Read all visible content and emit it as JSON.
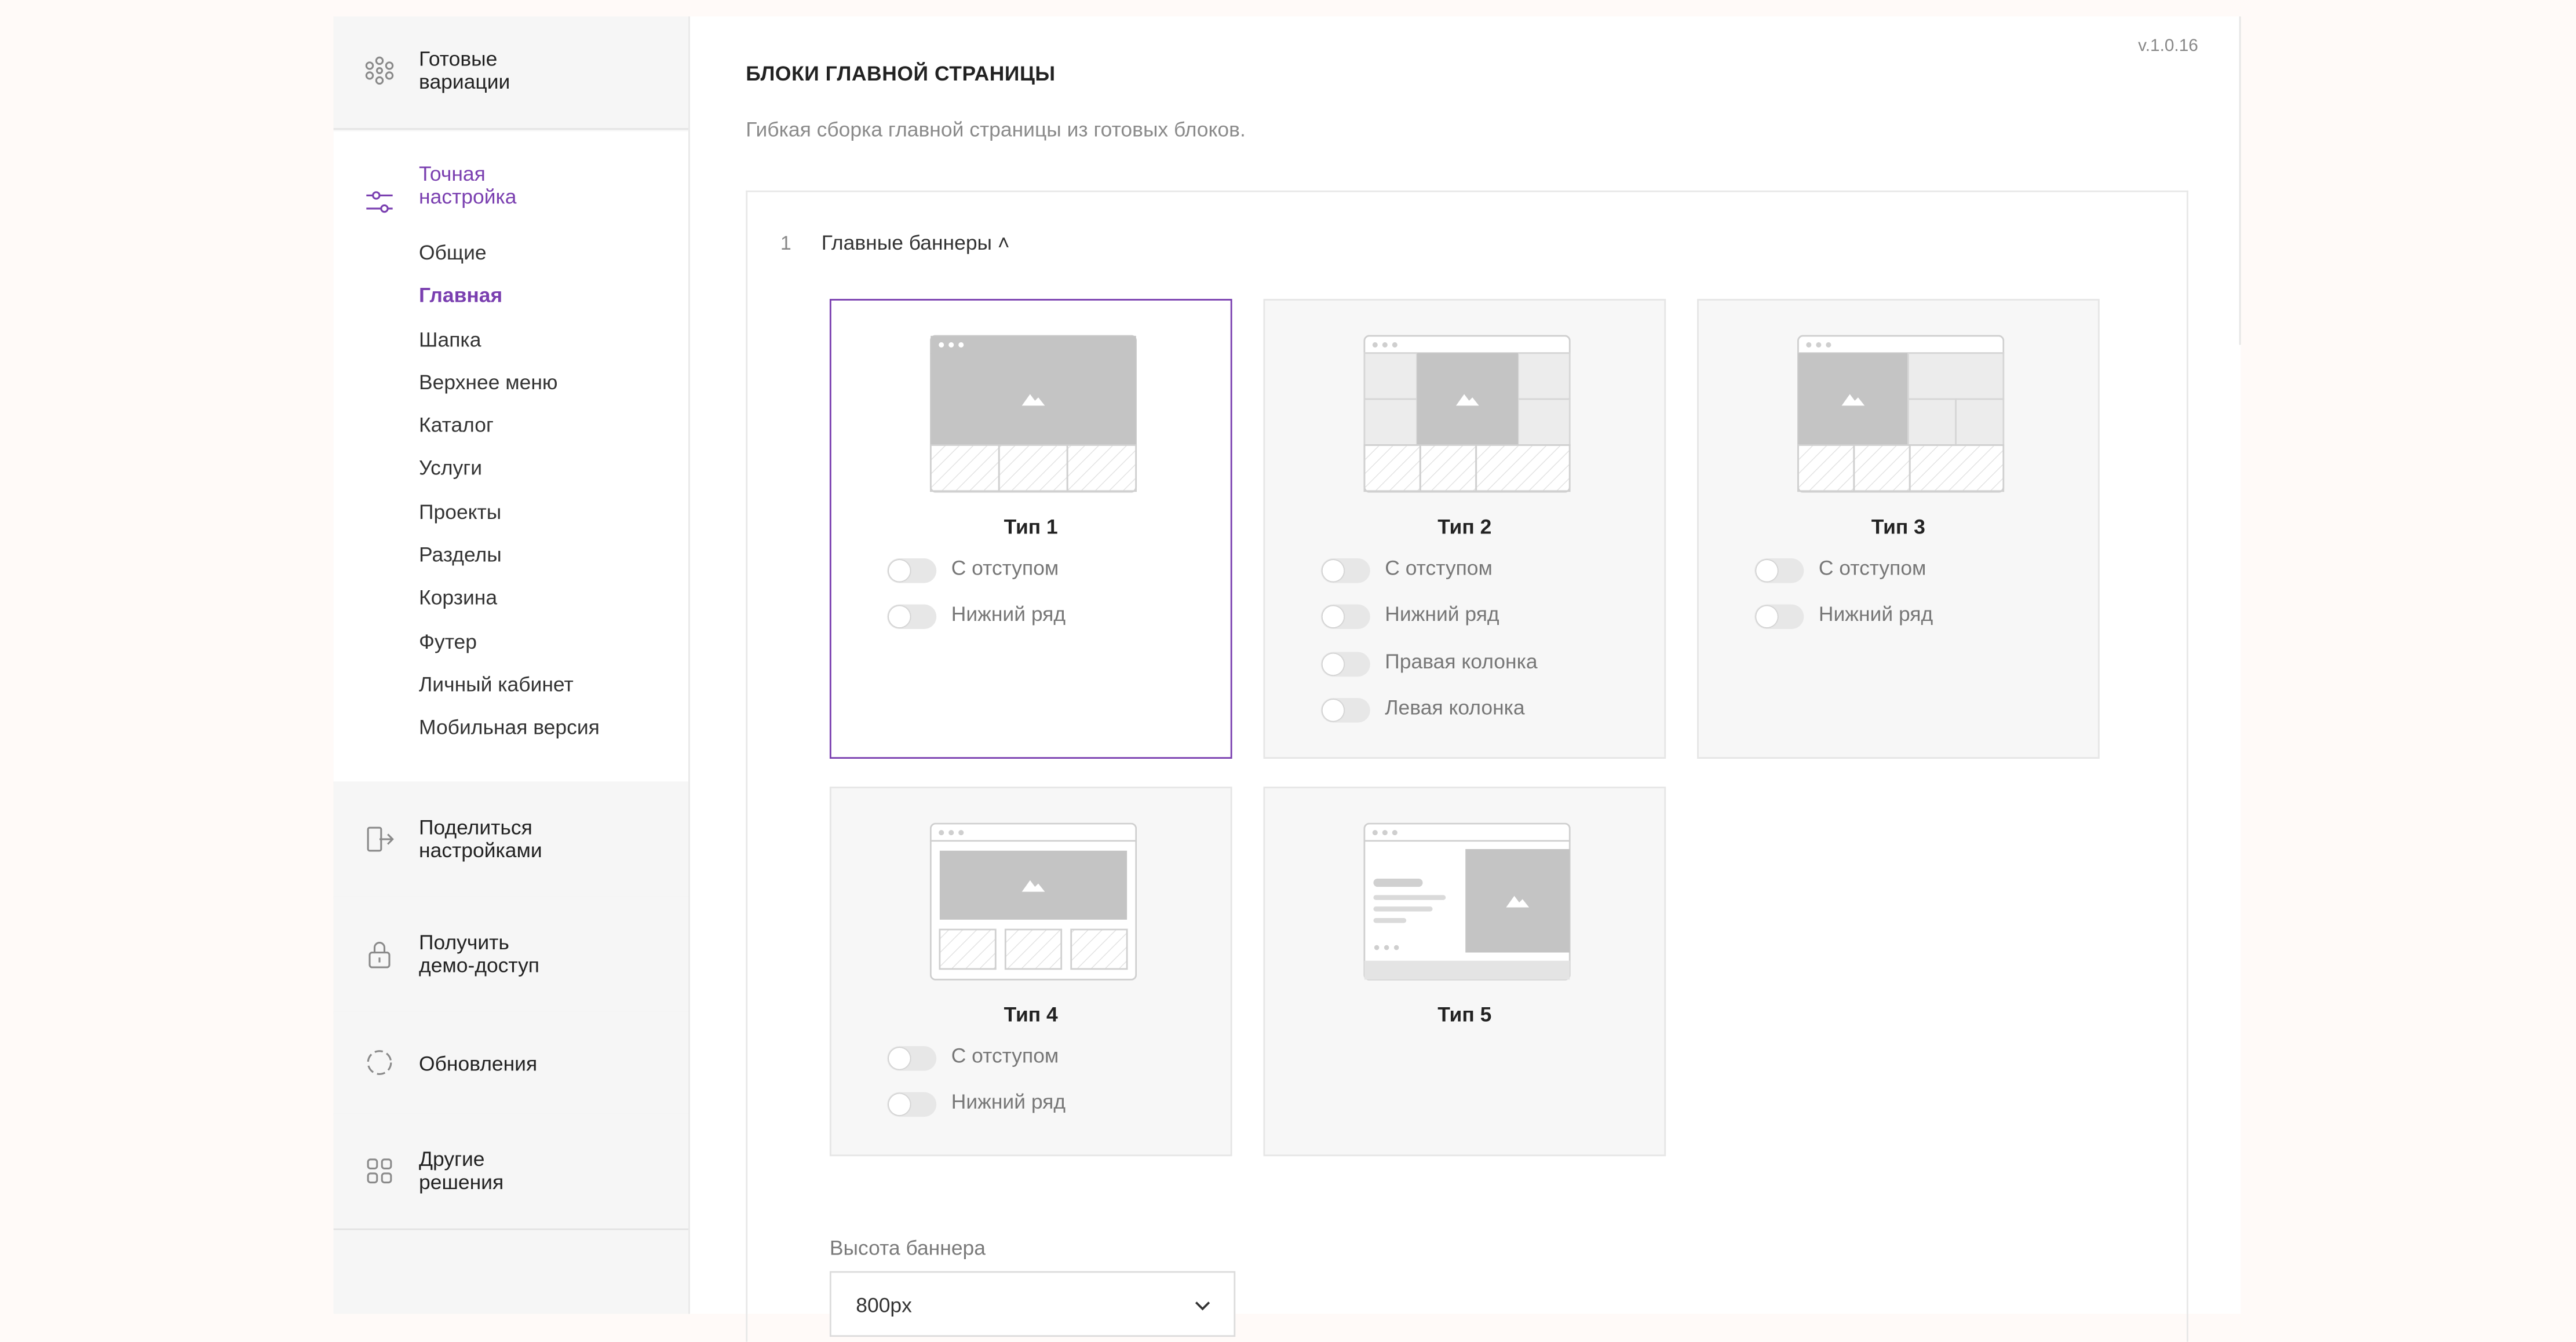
{
  "version": "v.1.0.16",
  "sidebar": {
    "ready_variations": "Готовые\nвариации",
    "fine_tuning": "Точная\nнастройка",
    "subnav": [
      "Общие",
      "Главная",
      "Шапка",
      "Верхнее меню",
      "Каталог",
      "Услуги",
      "Проекты",
      "Разделы",
      "Корзина",
      "Футер",
      "Личный кабинет",
      "Мобильная версия"
    ],
    "active_item": "Главная",
    "share": "Поделиться\nнастройками",
    "demo": "Получить\nдемо-доступ",
    "updates": "Обновления",
    "other": "Другие\nрешения"
  },
  "page": {
    "title": "БЛОКИ ГЛАВНОЙ СТРАНИЦЫ",
    "subtitle": "Гибкая сборка главной страницы из готовых блоков."
  },
  "section": {
    "number": "1",
    "title": "Главные баннеры ˄",
    "types": [
      {
        "name": "Тип 1",
        "selected": true,
        "options": [
          "С отступом",
          "Нижний ряд"
        ]
      },
      {
        "name": "Тип 2",
        "selected": false,
        "options": [
          "С отступом",
          "Нижний ряд",
          "Правая колонка",
          "Левая колонка"
        ]
      },
      {
        "name": "Тип 3",
        "selected": false,
        "options": [
          "С отступом",
          "Нижний ряд"
        ]
      },
      {
        "name": "Тип 4",
        "selected": false,
        "options": [
          "С отступом",
          "Нижний ряд"
        ]
      },
      {
        "name": "Тип 5",
        "selected": false,
        "options": []
      }
    ],
    "height_label": "Высота баннера",
    "height_value": "800px"
  },
  "colors": {
    "accent": "#7a3fb0",
    "sidebar_bg": "#f6f6f6",
    "card_bg": "#f7f7f7"
  },
  "icons": [
    "variations-icon",
    "sliders-icon",
    "share-icon",
    "lock-icon",
    "refresh-icon",
    "grid-icon",
    "chevron-down-icon",
    "image-icon"
  ]
}
